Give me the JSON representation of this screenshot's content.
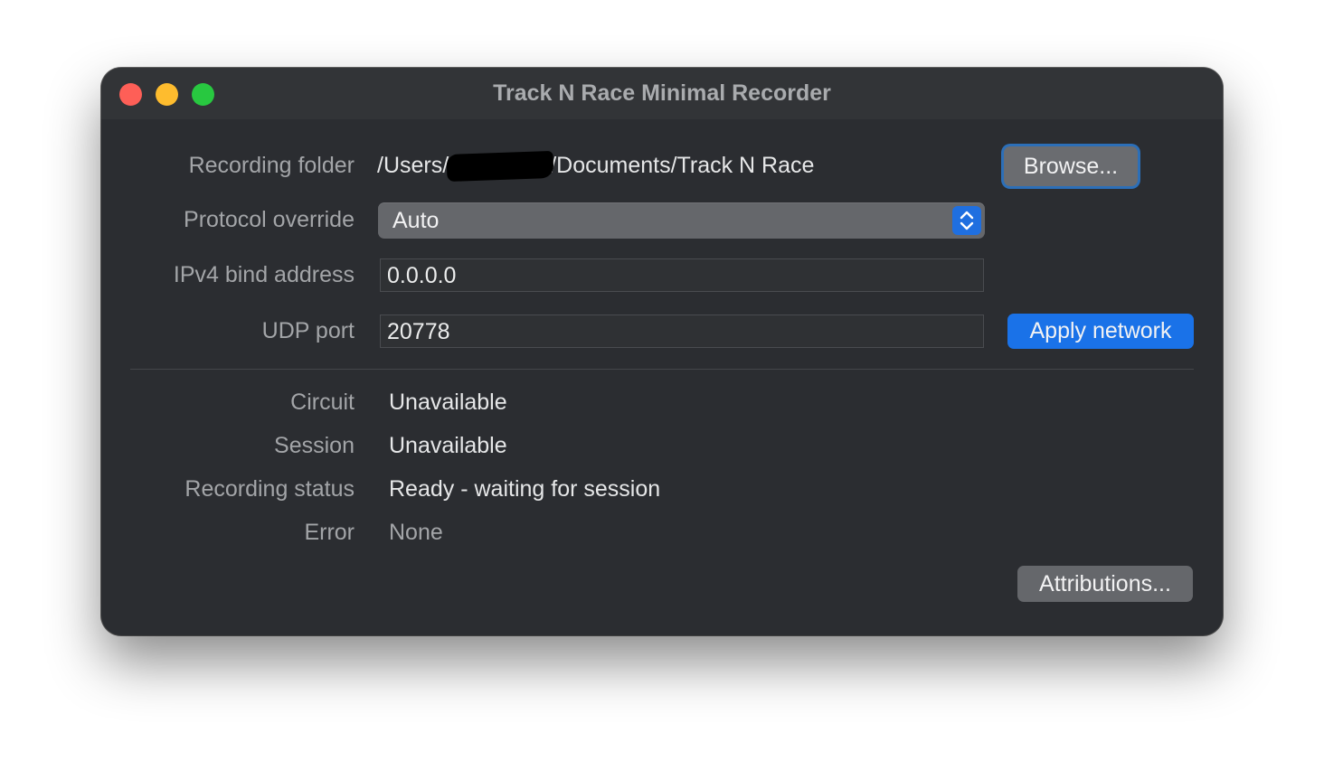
{
  "window": {
    "title": "Track N Race Minimal Recorder"
  },
  "form": {
    "recording_folder": {
      "label": "Recording folder",
      "value_prefix": "/Users/",
      "value_suffix": "/Documents/Track N Race",
      "button_label": "Browse..."
    },
    "protocol_override": {
      "label": "Protocol override",
      "selected": "Auto"
    },
    "ipv4_bind_address": {
      "label": "IPv4 bind address",
      "value": "0.0.0.0"
    },
    "udp_port": {
      "label": "UDP port",
      "value": "20778",
      "button_label": "Apply network"
    }
  },
  "status": {
    "circuit": {
      "label": "Circuit",
      "value": "Unavailable"
    },
    "session": {
      "label": "Session",
      "value": "Unavailable"
    },
    "recording_status": {
      "label": "Recording status",
      "value": "Ready - waiting for session"
    },
    "error": {
      "label": "Error",
      "value": "None"
    }
  },
  "footer": {
    "attributions_label": "Attributions..."
  },
  "colors": {
    "window_bg": "#2b2d31",
    "accent": "#1a72e8",
    "close": "#fe5f57",
    "minimize": "#febc2e",
    "maximize": "#28c840"
  },
  "icons": {
    "select_arrows": "chevron-up-down-icon"
  }
}
